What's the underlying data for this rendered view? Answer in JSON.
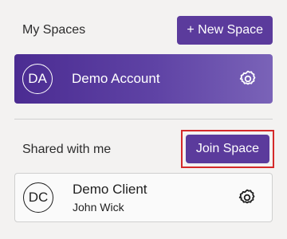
{
  "my_spaces": {
    "title": "My Spaces",
    "new_button": "+ New Space",
    "cards": [
      {
        "initials": "DA",
        "name": "Demo Account",
        "icon": "gear-icon"
      }
    ]
  },
  "shared": {
    "title": "Shared with me",
    "join_button": "Join Space",
    "cards": [
      {
        "initials": "DC",
        "name": "Demo Client",
        "owner": "John Wick",
        "icon": "gear-icon"
      }
    ]
  },
  "colors": {
    "accent": "#5b3b9c",
    "highlight": "#d42a2a"
  }
}
